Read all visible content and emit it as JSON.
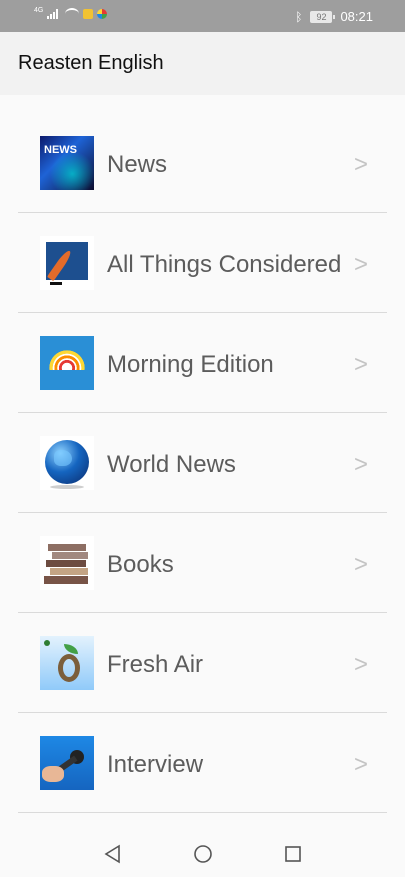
{
  "status_bar": {
    "network_label": "4G",
    "battery_level": "92",
    "time": "08:21",
    "icons": [
      "signal-icon",
      "wifi-icon",
      "notification-app-icon",
      "app-icon",
      "bluetooth-icon",
      "battery-icon"
    ]
  },
  "app_bar": {
    "title": "Reasten English"
  },
  "list": {
    "chevron": ">",
    "items": [
      {
        "label": "News",
        "thumb_text": "NEWS",
        "icon": "news-thumbnail"
      },
      {
        "label": "All Things Considered",
        "icon": "quill-thumbnail"
      },
      {
        "label": "Morning Edition",
        "icon": "sunrise-thumbnail"
      },
      {
        "label": "World News",
        "icon": "globe-thumbnail"
      },
      {
        "label": "Books",
        "icon": "books-thumbnail"
      },
      {
        "label": "Fresh Air",
        "icon": "plant-thumbnail"
      },
      {
        "label": "Interview",
        "icon": "microphone-thumbnail"
      }
    ]
  },
  "nav_bar": {
    "buttons": [
      "back-icon",
      "home-icon",
      "recents-icon"
    ]
  }
}
